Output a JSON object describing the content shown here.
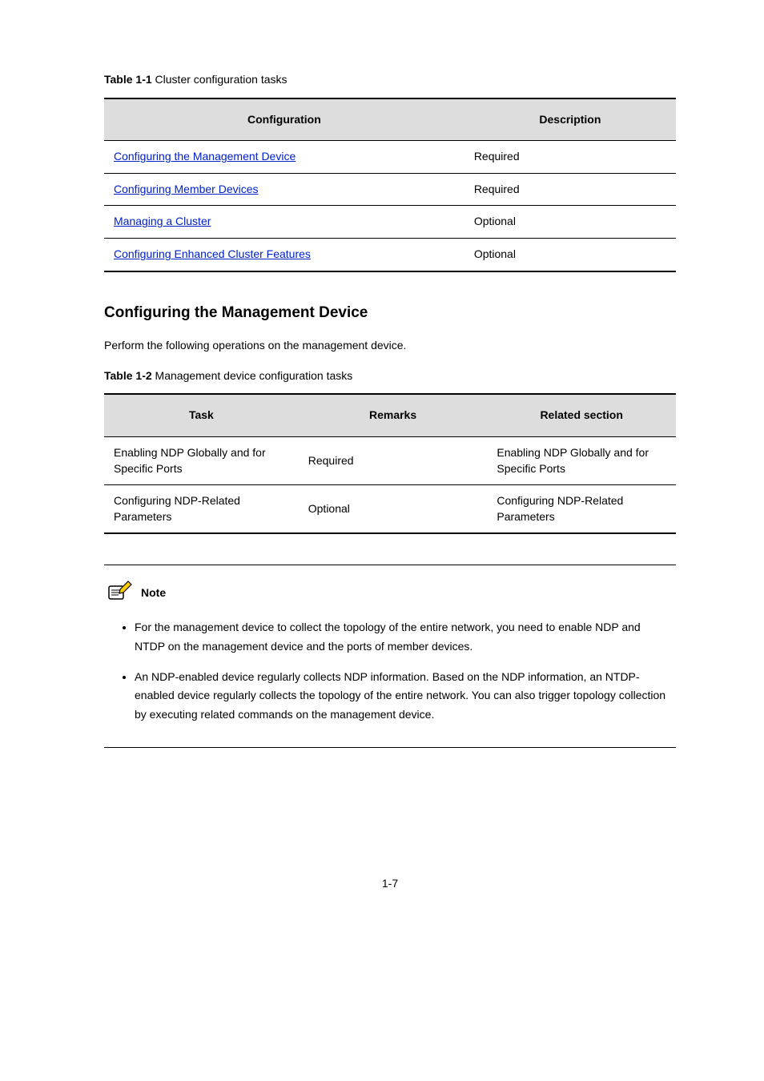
{
  "table1": {
    "caption_bold": "Table 1-1",
    "caption_rest": " Cluster configuration tasks",
    "headers": [
      "Configuration",
      "Description"
    ],
    "rows": [
      {
        "link": "Configuring the Management Device",
        "desc": "Required"
      },
      {
        "link": "Configuring Member Devices",
        "desc": "Required"
      },
      {
        "link": "Managing a Cluster",
        "desc": "Optional"
      },
      {
        "link": "Configuring Enhanced Cluster Features",
        "desc": "Optional"
      }
    ]
  },
  "section": {
    "title": "Configuring the Management Device",
    "intro": "Perform the following operations on the management device."
  },
  "table2": {
    "caption_bold": "Table 1-2",
    "caption_rest": " Management device configuration tasks",
    "headers": [
      "Task",
      "Remarks",
      "Related section"
    ],
    "rows": [
      {
        "c1a": "Enabling NDP Globally and for ",
        "c1b": "Specific Ports",
        "c2": "Required",
        "c3": "Enabling NDP Globally and for Specific Ports"
      },
      {
        "c1a": "Configuring NDP-Related ",
        "c1b": "Parameters",
        "c2": "Optional",
        "c3": "Configuring NDP-Related Parameters"
      }
    ]
  },
  "note": {
    "label": "Note",
    "bullets": [
      "For the management device to collect the topology of the entire network, you need to enable NDP and NTDP on the management device and the ports of member devices.",
      "An NDP-enabled device regularly collects NDP information. Based on the NDP information, an NTDP-enabled device regularly collects the topology of the entire network. You can also trigger topology collection by executing related commands on the management device."
    ]
  },
  "page_number": "1-7"
}
